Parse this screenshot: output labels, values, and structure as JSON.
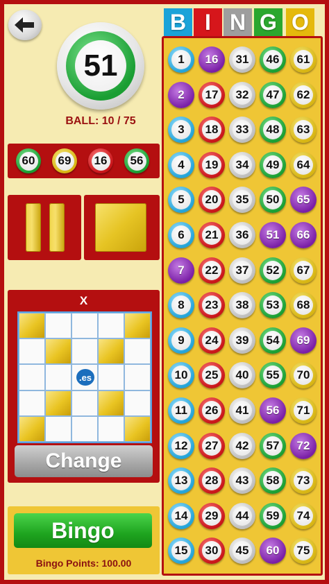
{
  "header": {
    "letters": [
      "B",
      "I",
      "N",
      "G",
      "O"
    ],
    "colors": [
      "#1aa3d9",
      "#d6161b",
      "#9e9e9e",
      "#2ba72e",
      "#e5b90c"
    ]
  },
  "current_ball": {
    "number": "51",
    "color": "green"
  },
  "ball_count": "BALL: 10 / 75",
  "last_balls": [
    {
      "number": "60",
      "color": "green"
    },
    {
      "number": "69",
      "color": "yellow"
    },
    {
      "number": "16",
      "color": "red"
    },
    {
      "number": "56",
      "color": "green"
    }
  ],
  "card": {
    "title": "X",
    "pattern": [
      [
        1,
        0,
        0,
        0,
        1
      ],
      [
        0,
        1,
        0,
        1,
        0
      ],
      [
        0,
        0,
        0,
        0,
        0
      ],
      [
        0,
        1,
        0,
        1,
        0
      ],
      [
        1,
        0,
        0,
        0,
        1
      ]
    ],
    "center_label": ".es"
  },
  "change_label": "Change",
  "bingo_label": "Bingo",
  "bingo_points": "Bingo Points: 100.00",
  "called_numbers": [
    16,
    2,
    65,
    51,
    66,
    7,
    69,
    56,
    72,
    60
  ],
  "column_colors": {
    "B": "#3fb6e3",
    "I": "#d9262b",
    "N": "#b9b9b9",
    "G": "#2ba72e",
    "O": "#e2c21b",
    "called": "#8e2bb8"
  }
}
